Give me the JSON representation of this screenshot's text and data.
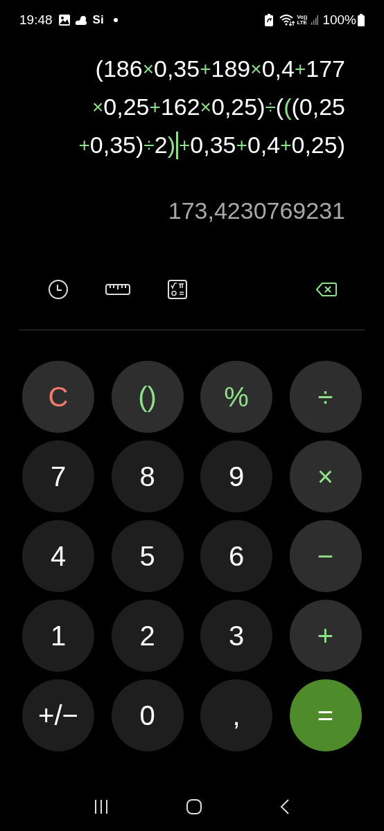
{
  "status_bar": {
    "time": "19:48",
    "app_label": "Si",
    "volte": "Vo))",
    "lte": "LTE",
    "battery": "100%"
  },
  "expression": {
    "lines": [
      [
        {
          "kind": "number",
          "text": "(186"
        },
        {
          "kind": "operator",
          "text": "×"
        },
        {
          "kind": "number",
          "text": "0,35"
        },
        {
          "kind": "operator",
          "text": "+"
        },
        {
          "kind": "number",
          "text": "189"
        },
        {
          "kind": "operator",
          "text": "×"
        },
        {
          "kind": "number",
          "text": "0,4"
        },
        {
          "kind": "operator",
          "text": "+"
        },
        {
          "kind": "number",
          "text": "177"
        }
      ],
      [
        {
          "kind": "operator",
          "text": "×"
        },
        {
          "kind": "number",
          "text": "0,25"
        },
        {
          "kind": "operator",
          "text": "+"
        },
        {
          "kind": "number",
          "text": "162"
        },
        {
          "kind": "operator",
          "text": "×"
        },
        {
          "kind": "number",
          "text": "0,25)"
        },
        {
          "kind": "operator",
          "text": "÷"
        },
        {
          "kind": "number",
          "text": "("
        },
        {
          "kind": "match",
          "text": "("
        },
        {
          "kind": "number",
          "text": "(0,25"
        }
      ],
      [
        {
          "kind": "operator",
          "text": "+"
        },
        {
          "kind": "number",
          "text": "0,35)"
        },
        {
          "kind": "operator",
          "text": "÷"
        },
        {
          "kind": "number",
          "text": "2"
        },
        {
          "kind": "match",
          "text": ")"
        },
        {
          "kind": "cursor"
        },
        {
          "kind": "operator",
          "text": "+"
        },
        {
          "kind": "number",
          "text": "0,35"
        },
        {
          "kind": "operator",
          "text": "+"
        },
        {
          "kind": "number",
          "text": "0,4"
        },
        {
          "kind": "operator",
          "text": "+"
        },
        {
          "kind": "number",
          "text": "0,25)"
        }
      ]
    ]
  },
  "result": "173,4230769231",
  "keys": [
    {
      "kind": "clear",
      "label": "C"
    },
    {
      "kind": "function",
      "label": "()"
    },
    {
      "kind": "function",
      "label": "%"
    },
    {
      "kind": "operator",
      "label": "÷"
    },
    {
      "kind": "digit",
      "label": "7"
    },
    {
      "kind": "digit",
      "label": "8"
    },
    {
      "kind": "digit",
      "label": "9"
    },
    {
      "kind": "operator",
      "label": "×"
    },
    {
      "kind": "digit",
      "label": "4"
    },
    {
      "kind": "digit",
      "label": "5"
    },
    {
      "kind": "digit",
      "label": "6"
    },
    {
      "kind": "operator",
      "label": "−"
    },
    {
      "kind": "digit",
      "label": "1"
    },
    {
      "kind": "digit",
      "label": "2"
    },
    {
      "kind": "digit",
      "label": "3"
    },
    {
      "kind": "operator",
      "label": "+"
    },
    {
      "kind": "digit",
      "label": "+/−"
    },
    {
      "kind": "digit",
      "label": "0"
    },
    {
      "kind": "digit",
      "label": ","
    },
    {
      "kind": "equals",
      "label": "="
    }
  ]
}
